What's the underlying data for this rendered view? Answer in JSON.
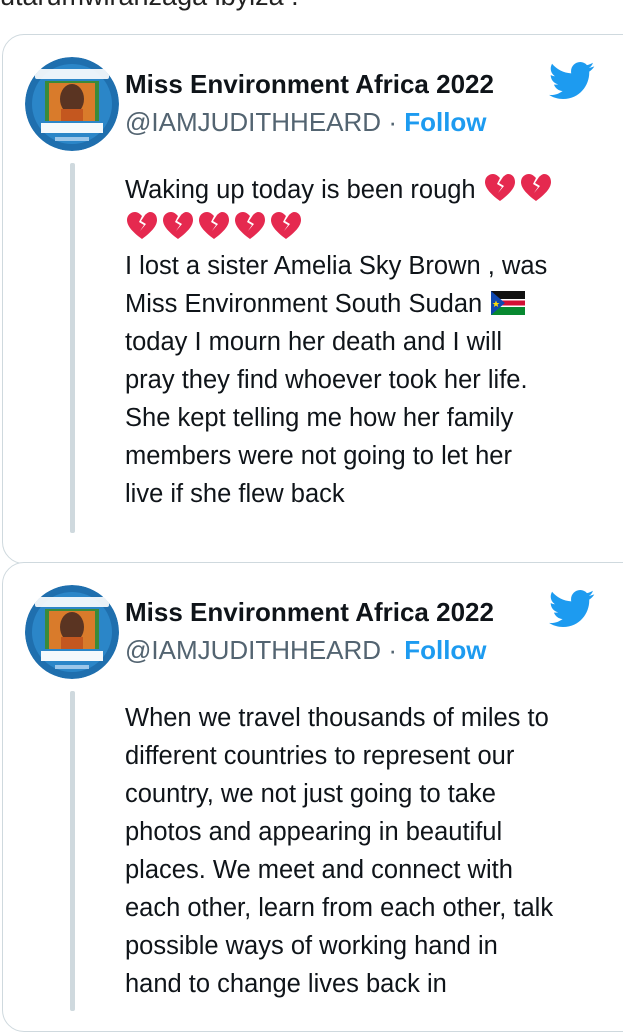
{
  "top_text": "utarumwiranzaga ibyiza .",
  "colors": {
    "follow": "#1d9bf0",
    "twitter": "#1d9bf0",
    "border": "#cfd9de",
    "heart": "#e5294f"
  },
  "tweets": [
    {
      "name": "Miss Environment Africa 2022",
      "handle": "@IAMJUDITHHEARD",
      "separator": "·",
      "follow": "Follow",
      "avatar_badge_top": "BEST DIPLOMATS",
      "avatar_badge_bottom": "UNITED NATIONS SIMULATIONS",
      "lines": [
        "Waking up today is been rough",
        "",
        "I lost a sister Amelia Sky Brown , was",
        "Miss Environment South Sudan",
        "today I mourn her death and I will",
        "pray they find whoever took her life.",
        "She kept telling me how her family",
        "members were not going to let her",
        "live if she flew back"
      ],
      "emoji": [
        "broken-heart",
        "south-sudan-flag"
      ]
    },
    {
      "name": "Miss Environment Africa 2022",
      "handle": "@IAMJUDITHHEARD",
      "separator": "·",
      "follow": "Follow",
      "avatar_badge_top": "BEST DIPLOMATS",
      "avatar_badge_bottom": "UNITED NATIONS SIMULATIONS",
      "lines": [
        "When we travel thousands of miles to",
        "different countries to represent our",
        "country, we not just going to take",
        "photos and appearing in beautiful",
        "places. We meet and connect with",
        "each other, learn from each other, talk",
        "possible ways of working hand in",
        "hand to change lives back in"
      ]
    }
  ]
}
